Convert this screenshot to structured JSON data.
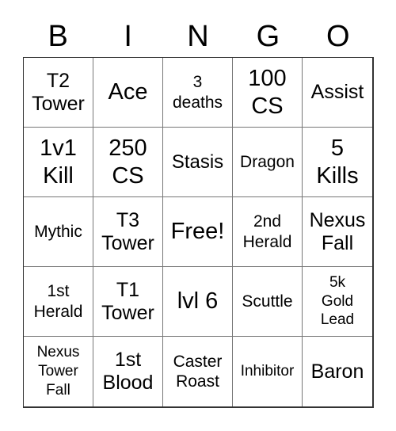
{
  "header": {
    "letters": [
      "B",
      "I",
      "N",
      "G",
      "O"
    ]
  },
  "board": {
    "cells": [
      {
        "text": "T2\nTower",
        "size": "m"
      },
      {
        "text": "Ace",
        "size": "l"
      },
      {
        "text": "3\ndeaths",
        "size": "s"
      },
      {
        "text": "100\nCS",
        "size": "l"
      },
      {
        "text": "Assist",
        "size": "m"
      },
      {
        "text": "1v1\nKill",
        "size": "l"
      },
      {
        "text": "250\nCS",
        "size": "l"
      },
      {
        "text": "Stasis",
        "size": "ms"
      },
      {
        "text": "Dragon",
        "size": "s"
      },
      {
        "text": "5\nKills",
        "size": "l"
      },
      {
        "text": "Mythic",
        "size": "s"
      },
      {
        "text": "T3\nTower",
        "size": "m"
      },
      {
        "text": "Free!",
        "size": "l"
      },
      {
        "text": "2nd\nHerald",
        "size": "s"
      },
      {
        "text": "Nexus\nFall",
        "size": "m"
      },
      {
        "text": "1st\nHerald",
        "size": "s"
      },
      {
        "text": "T1\nTower",
        "size": "m"
      },
      {
        "text": "lvl 6",
        "size": "l"
      },
      {
        "text": "Scuttle",
        "size": "s"
      },
      {
        "text": "5k\nGold\nLead",
        "size": "xs"
      },
      {
        "text": "Nexus\nTower\nFall",
        "size": "xs"
      },
      {
        "text": "1st\nBlood",
        "size": "m"
      },
      {
        "text": "Caster\nRoast",
        "size": "s"
      },
      {
        "text": "Inhibitor",
        "size": "xs"
      },
      {
        "text": "Baron",
        "size": "m"
      }
    ]
  }
}
